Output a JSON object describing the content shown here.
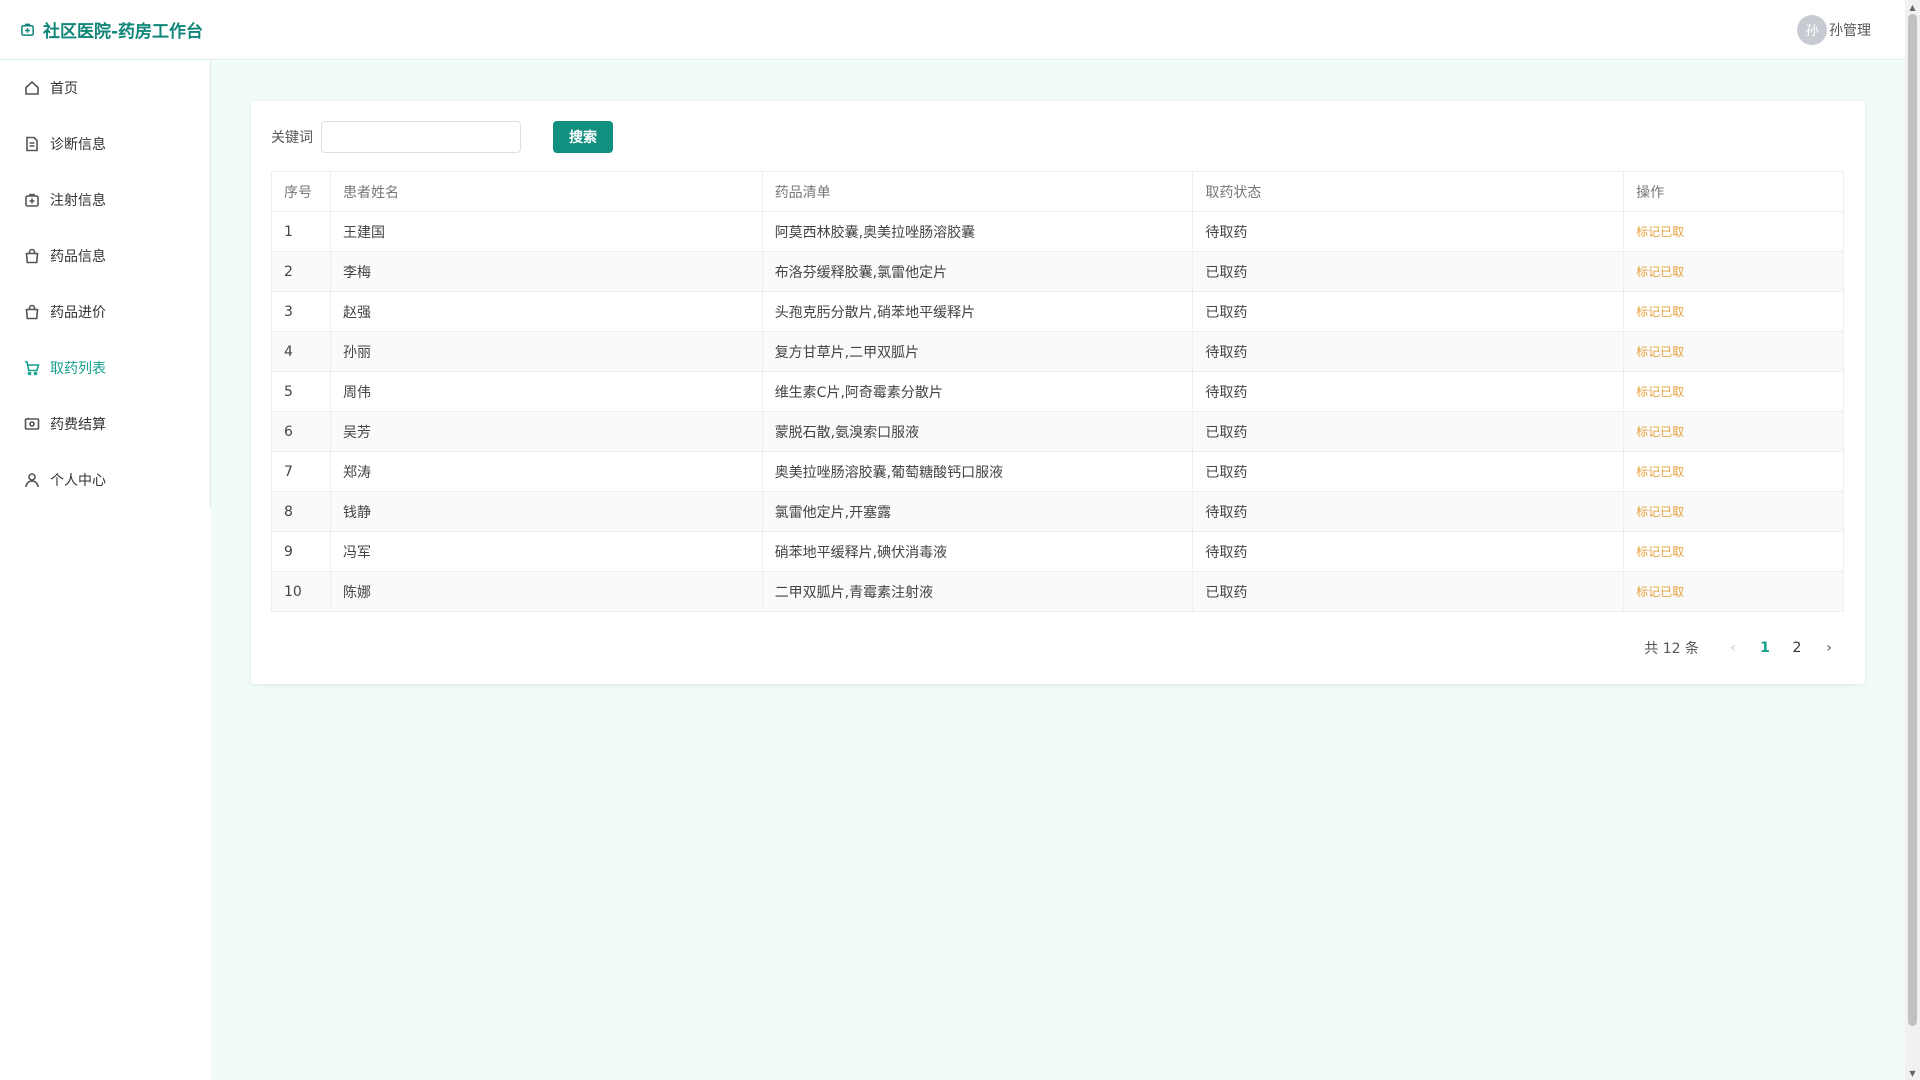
{
  "header": {
    "title": "社区医院-药房工作台",
    "user_avatar": "孙",
    "user_name": "孙管理"
  },
  "sidebar": {
    "items": [
      {
        "label": "首页",
        "icon": "home-icon"
      },
      {
        "label": "诊断信息",
        "icon": "document-icon"
      },
      {
        "label": "注射信息",
        "icon": "medical-box-icon"
      },
      {
        "label": "药品信息",
        "icon": "bag-icon"
      },
      {
        "label": "药品进价",
        "icon": "bag-icon"
      },
      {
        "label": "取药列表",
        "icon": "cart-icon",
        "active": true
      },
      {
        "label": "药费结算",
        "icon": "wallet-icon"
      },
      {
        "label": "个人中心",
        "icon": "user-icon"
      }
    ]
  },
  "search": {
    "label": "关键词",
    "value": "",
    "placeholder": "",
    "button": "搜索"
  },
  "table": {
    "headers": [
      "序号",
      "患者姓名",
      "药品清单",
      "取药状态",
      "操作"
    ],
    "rows": [
      {
        "no": "1",
        "name": "王建国",
        "drugs": "阿莫西林胶囊,奥美拉唑肠溶胶囊",
        "status": "待取药",
        "op": "标记已取"
      },
      {
        "no": "2",
        "name": "李梅",
        "drugs": "布洛芬缓释胶囊,氯雷他定片",
        "status": "已取药",
        "op": "标记已取"
      },
      {
        "no": "3",
        "name": "赵强",
        "drugs": "头孢克肟分散片,硝苯地平缓释片",
        "status": "已取药",
        "op": "标记已取"
      },
      {
        "no": "4",
        "name": "孙丽",
        "drugs": "复方甘草片,二甲双胍片",
        "status": "待取药",
        "op": "标记已取"
      },
      {
        "no": "5",
        "name": "周伟",
        "drugs": "维生素C片,阿奇霉素分散片",
        "status": "待取药",
        "op": "标记已取"
      },
      {
        "no": "6",
        "name": "吴芳",
        "drugs": "蒙脱石散,氨溴索口服液",
        "status": "已取药",
        "op": "标记已取"
      },
      {
        "no": "7",
        "name": "郑涛",
        "drugs": "奥美拉唑肠溶胶囊,葡萄糖酸钙口服液",
        "status": "已取药",
        "op": "标记已取"
      },
      {
        "no": "8",
        "name": "钱静",
        "drugs": "氯雷他定片,开塞露",
        "status": "待取药",
        "op": "标记已取"
      },
      {
        "no": "9",
        "name": "冯军",
        "drugs": "硝苯地平缓释片,碘伏消毒液",
        "status": "待取药",
        "op": "标记已取"
      },
      {
        "no": "10",
        "name": "陈娜",
        "drugs": "二甲双胍片,青霉素注射液",
        "status": "已取药",
        "op": "标记已取"
      }
    ]
  },
  "pagination": {
    "total_text": "共 12 条",
    "pages": [
      "1",
      "2"
    ],
    "current": "1"
  },
  "colors": {
    "brand": "#10857a",
    "active": "#13a08e",
    "button": "#118f7f",
    "link": "#e6a23c",
    "main_bg": "#f1fbf9"
  }
}
